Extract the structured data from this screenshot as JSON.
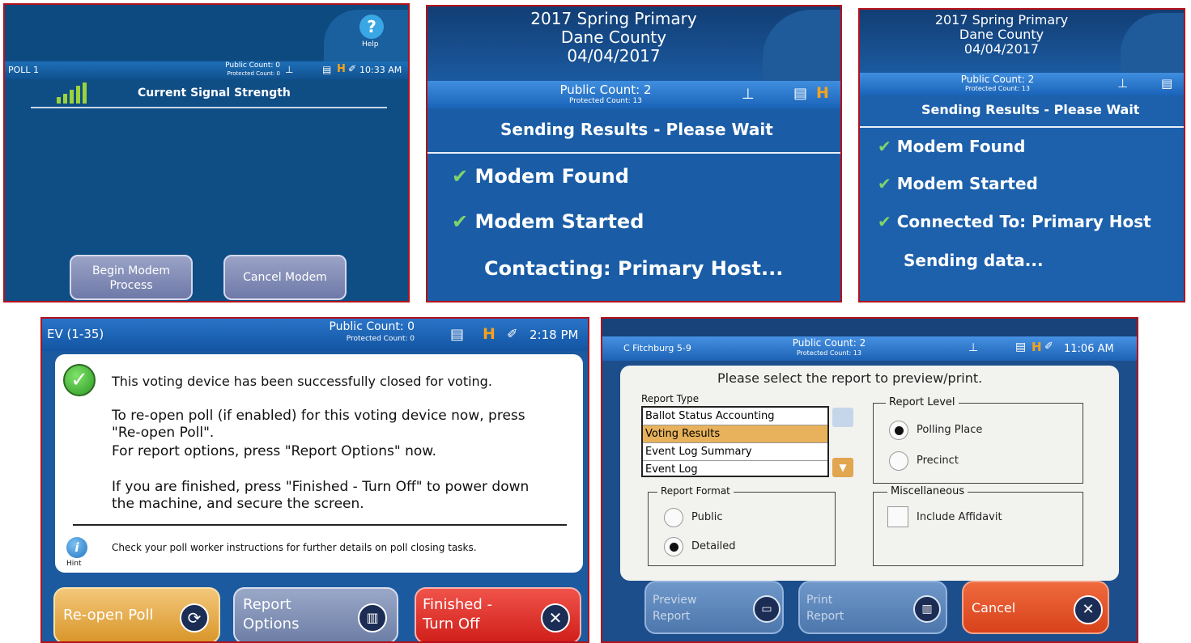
{
  "panel1": {
    "help_glyph": "?",
    "help_label": "Help",
    "poll": "POLL 1",
    "public_count": "Public Count: 0",
    "protected_count": "Protected Count: 0",
    "time": "10:33 AM",
    "heading": "Current Signal Strength",
    "begin_button": "Begin Modem Process",
    "cancel_button": "Cancel Modem",
    "signal_bars": 5
  },
  "panel2": {
    "title_line1": "2017 Spring Primary",
    "title_line2": "Dane County",
    "title_line3": "04/04/2017",
    "public_count": "Public Count: 2",
    "protected_count": "Protected Count: 13",
    "status_heading": "Sending Results - Please Wait",
    "line1": "Modem Found",
    "line2": "Modem Started",
    "line3": "Contacting: Primary Host..."
  },
  "panel3": {
    "title_line1": "2017 Spring Primary",
    "title_line2": "Dane County",
    "title_line3": "04/04/2017",
    "public_count": "Public Count: 2",
    "protected_count": "Protected Count: 13",
    "status_heading": "Sending Results - Please Wait",
    "line1": "Modem Found",
    "line2": "Modem Started",
    "line3": "Connected To: Primary Host",
    "line4": "Sending data..."
  },
  "panel4": {
    "poll": "EV (1-35)",
    "public_count": "Public Count: 0",
    "protected_count": "Protected Count: 0",
    "time": "2:18 PM",
    "msg1": "This voting device has been successfully closed for voting.",
    "msg2": "To re-open poll (if enabled) for this voting device now, press \"Re-open Poll\".",
    "msg3": "For report options, press \"Report Options\" now.",
    "msg4": "If you are finished, press \"Finished - Turn Off\" to power down the machine, and secure the screen.",
    "hint": "Check your poll worker instructions for further details on poll closing tasks.",
    "hint_label": "Hint",
    "reopen_button": "Re-open Poll",
    "report_line1": "Report",
    "report_line2": "Options",
    "finished_line1": "Finished -",
    "finished_line2": "Turn Off"
  },
  "panel5": {
    "poll": "C Fitchburg 5-9",
    "public_count": "Public Count: 2",
    "protected_count": "Protected Count: 13",
    "time": "11:06 AM",
    "prompt": "Please select the report to preview/print.",
    "report_type_label": "Report Type",
    "report_types": [
      "Ballot Status Accounting",
      "Voting Results",
      "Event Log Summary",
      "Event Log"
    ],
    "selected_report": "Voting Results",
    "report_level_label": "Report Level",
    "level_options": [
      "Polling Place",
      "Precinct"
    ],
    "report_format_label": "Report Format",
    "format_options": [
      "Public",
      "Detailed"
    ],
    "misc_label": "Miscellaneous",
    "include_affidavit": "Include Affidavit",
    "preview_line1": "Preview",
    "preview_line2": "Report",
    "print_line1": "Print",
    "print_line2": "Report",
    "cancel_button": "Cancel"
  },
  "colors": {
    "frame": "#b3121b",
    "screen_blue": "#0f4d85",
    "check_green": "#7fd46a",
    "reopen_gold": "#e3a93e",
    "finished_red": "#e0312c",
    "selected_row": "#e7b25b"
  }
}
